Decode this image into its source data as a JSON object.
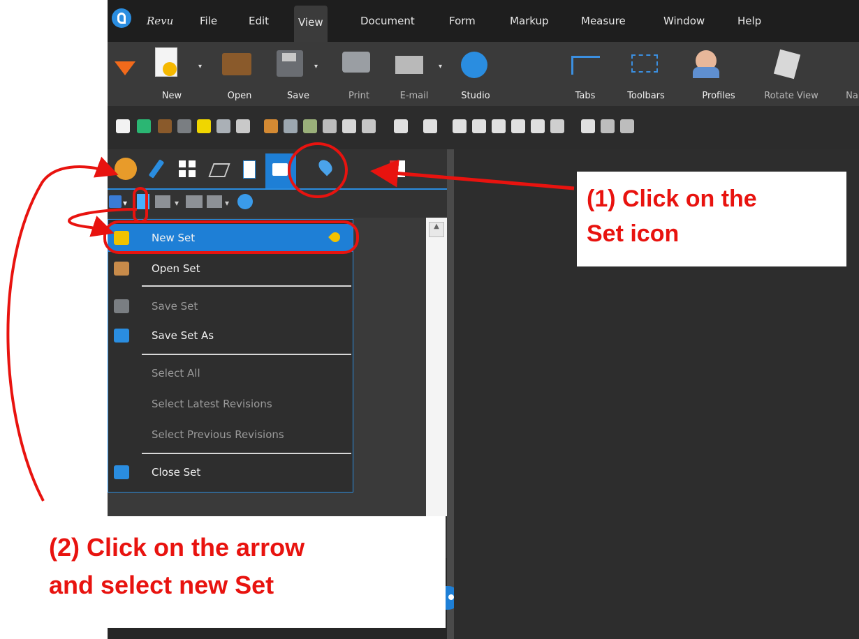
{
  "menu": [
    "Revu",
    "File",
    "Edit",
    "View",
    "Document",
    "Form",
    "Markup",
    "Measure",
    "Window",
    "Help"
  ],
  "ribbon": {
    "buttons": [
      "New",
      "Open",
      "Save",
      "Print",
      "E-mail",
      "Studio",
      "Tabs",
      "Toolbars",
      "Profiles",
      "Rotate View",
      "Na"
    ]
  },
  "dropdown": {
    "items": [
      "New Set",
      "Open Set",
      "Save Set",
      "Save Set As",
      "Select All",
      "Select Latest Revisions",
      "Select Previous Revisions",
      "Close Set"
    ]
  },
  "callouts": {
    "one_line1": "(1) Click on the",
    "one_line2": "Set icon",
    "two_line1": "(2) Click on the arrow",
    "two_line2": "and select new Set"
  },
  "colors": {
    "accent": "#1e7fd6",
    "annotation": "#e8130f",
    "toolbar_bg": "#3a3a3a",
    "menubar_bg": "#1e1e1e"
  },
  "icons": [
    "revu-logo-icon",
    "new-icon",
    "open-icon",
    "save-icon",
    "print-icon",
    "email-icon",
    "studio-icon",
    "tabs-icon",
    "toolbars-icon",
    "profiles-icon",
    "rotate-view-icon",
    "sets-icon",
    "new-set-icon",
    "open-set-icon",
    "save-set-icon",
    "save-set-as-icon",
    "close-set-icon",
    "pin-icon"
  ]
}
